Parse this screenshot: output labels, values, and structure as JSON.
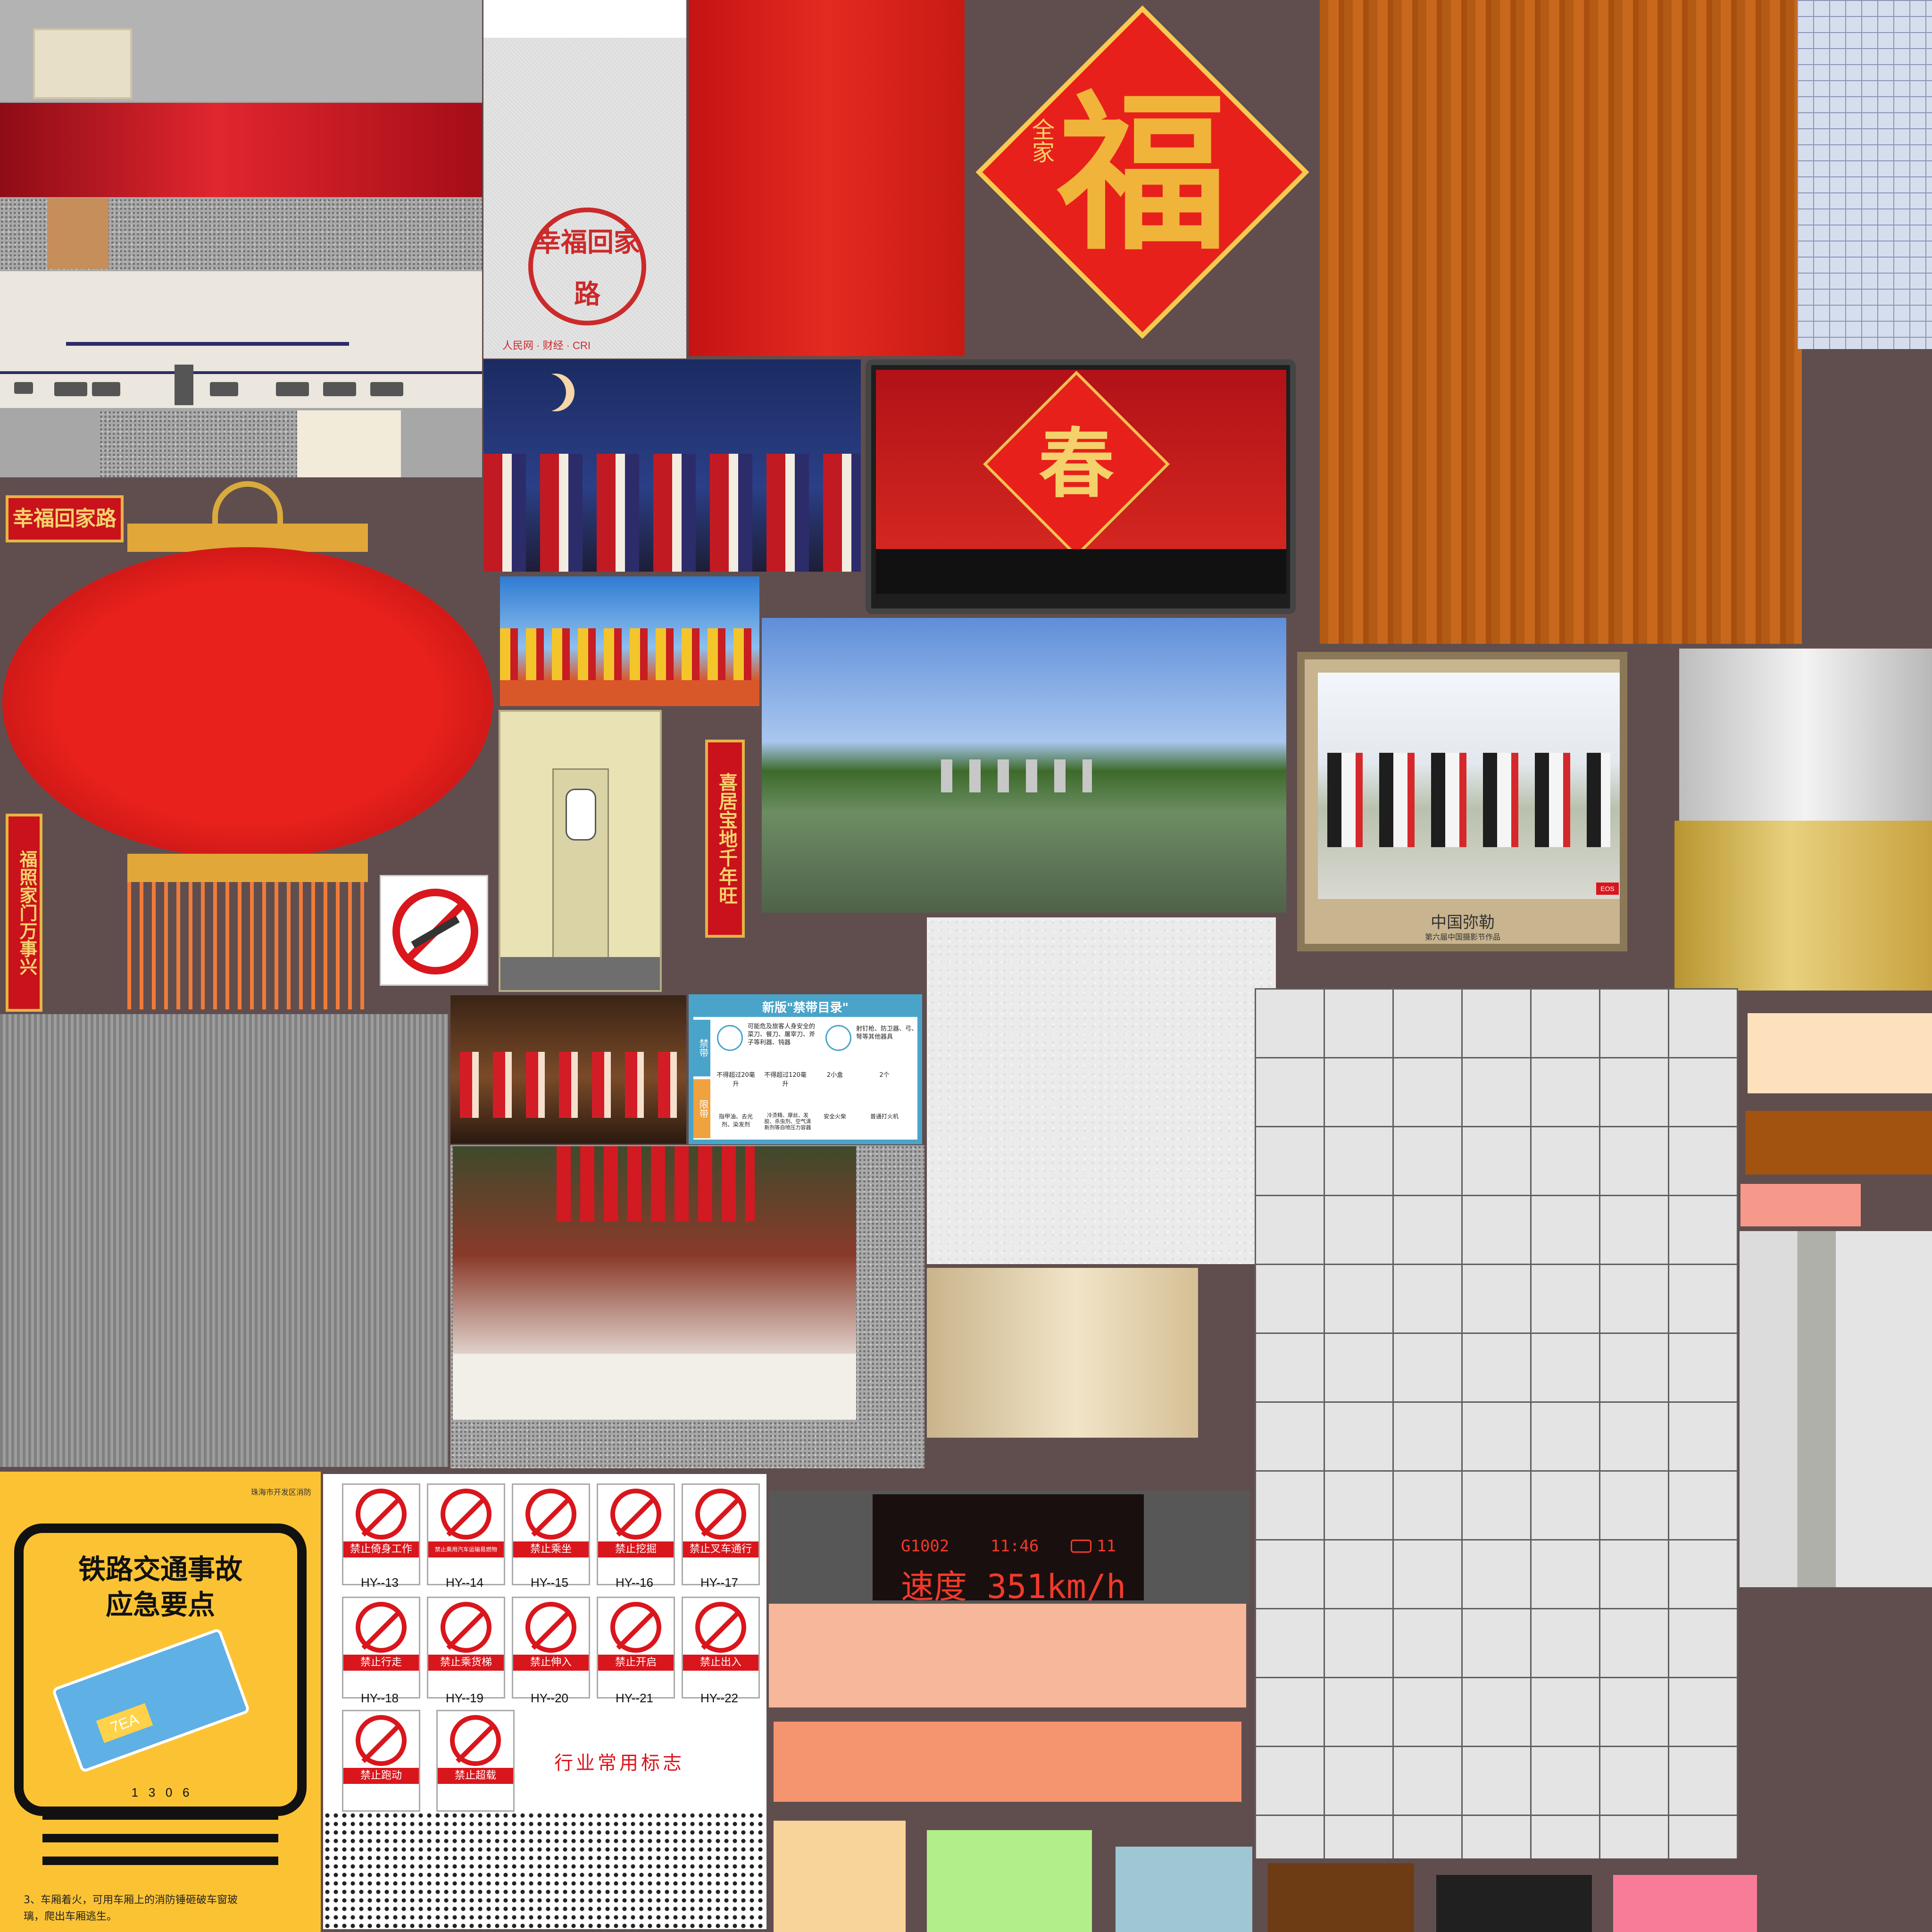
{
  "atlas": {
    "banner_label": "幸福回家路",
    "couplet_left": "福照家门万事兴",
    "couplet_right": "喜居宝地千年旺",
    "fu_char": "福",
    "fu_side": "全家",
    "chun_char": "春",
    "papercut_text": "幸福回家路",
    "poster_logos": "人民网  ·  财经  ·  CRI",
    "miloh_caption": "中国弥勒",
    "miloh_sub": "第六届中国摄影节作品",
    "miloh_tag": "EOS",
    "contraband": {
      "title": "新版\"禁带目录\"",
      "left_tags": [
        "禁带",
        "限带"
      ],
      "row1_a": "可能危及旅客人身安全的菜刀、餐刀、屠宰刀、斧子等利器、钝器",
      "row1_b": "射钉枪、防卫器、弓、弩等其他器具",
      "row2": [
        {
          "top": "不得超过20毫升",
          "bottom": "指甲油、去光剂、染发剂"
        },
        {
          "top": "不得超过120毫升",
          "bottom": "冷烫精、摩丝、发胶、杀虫剂、空气清新剂等自喷压力容器"
        },
        {
          "top": "2小盒",
          "bottom": "安全火柴"
        },
        {
          "top": "2个",
          "bottom": "普通打火机"
        }
      ]
    },
    "train_display": {
      "train_no": "G1002",
      "time": "11:46",
      "car": "11",
      "speed_text": "速度 351km/h"
    },
    "poster_yellow": {
      "org": "珠海市开发区消防",
      "title_line1": "铁路交通事故",
      "title_line2": "应急要点",
      "ticket_code": "7EA",
      "ticket_nums": "1   3   0   6",
      "body_line1": "3、车厢着火，可用车厢上的消防锤砸破车窗玻",
      "body_line2": "璃，爬出车厢逃生。"
    },
    "signs": [
      {
        "label": "禁止倚身工作",
        "code": "HY--13"
      },
      {
        "label": "禁止乘用汽车运输易燃物",
        "code": "HY--14"
      },
      {
        "label": "禁止乘坐",
        "code": "HY--15"
      },
      {
        "label": "禁止挖掘",
        "code": "HY--16"
      },
      {
        "label": "禁止叉车通行",
        "code": "HY--17"
      },
      {
        "label": "禁止行走",
        "code": "HY--18"
      },
      {
        "label": "禁止乘货梯",
        "code": "HY--19"
      },
      {
        "label": "禁止伸入",
        "code": "HY--20"
      },
      {
        "label": "禁止开启",
        "code": "HY--21"
      },
      {
        "label": "禁止出入",
        "code": "HY--22"
      },
      {
        "label": "禁止跑动",
        "code": ""
      },
      {
        "label": "禁止超载",
        "code": ""
      }
    ],
    "signs_caption": "行业常用标志",
    "swatches": {
      "peach_wide": "#f6b79a",
      "salmon_wide": "#f4956f",
      "light_orange": "#f8d39a",
      "light_green": "#b2ef88",
      "light_blue": "#9ec6d3",
      "brown": "#6e3c14",
      "black": "#202020",
      "pink": "#f87b97",
      "cream": "#fde1bd",
      "rust": "#a2530f",
      "coral": "#f7998a"
    }
  }
}
